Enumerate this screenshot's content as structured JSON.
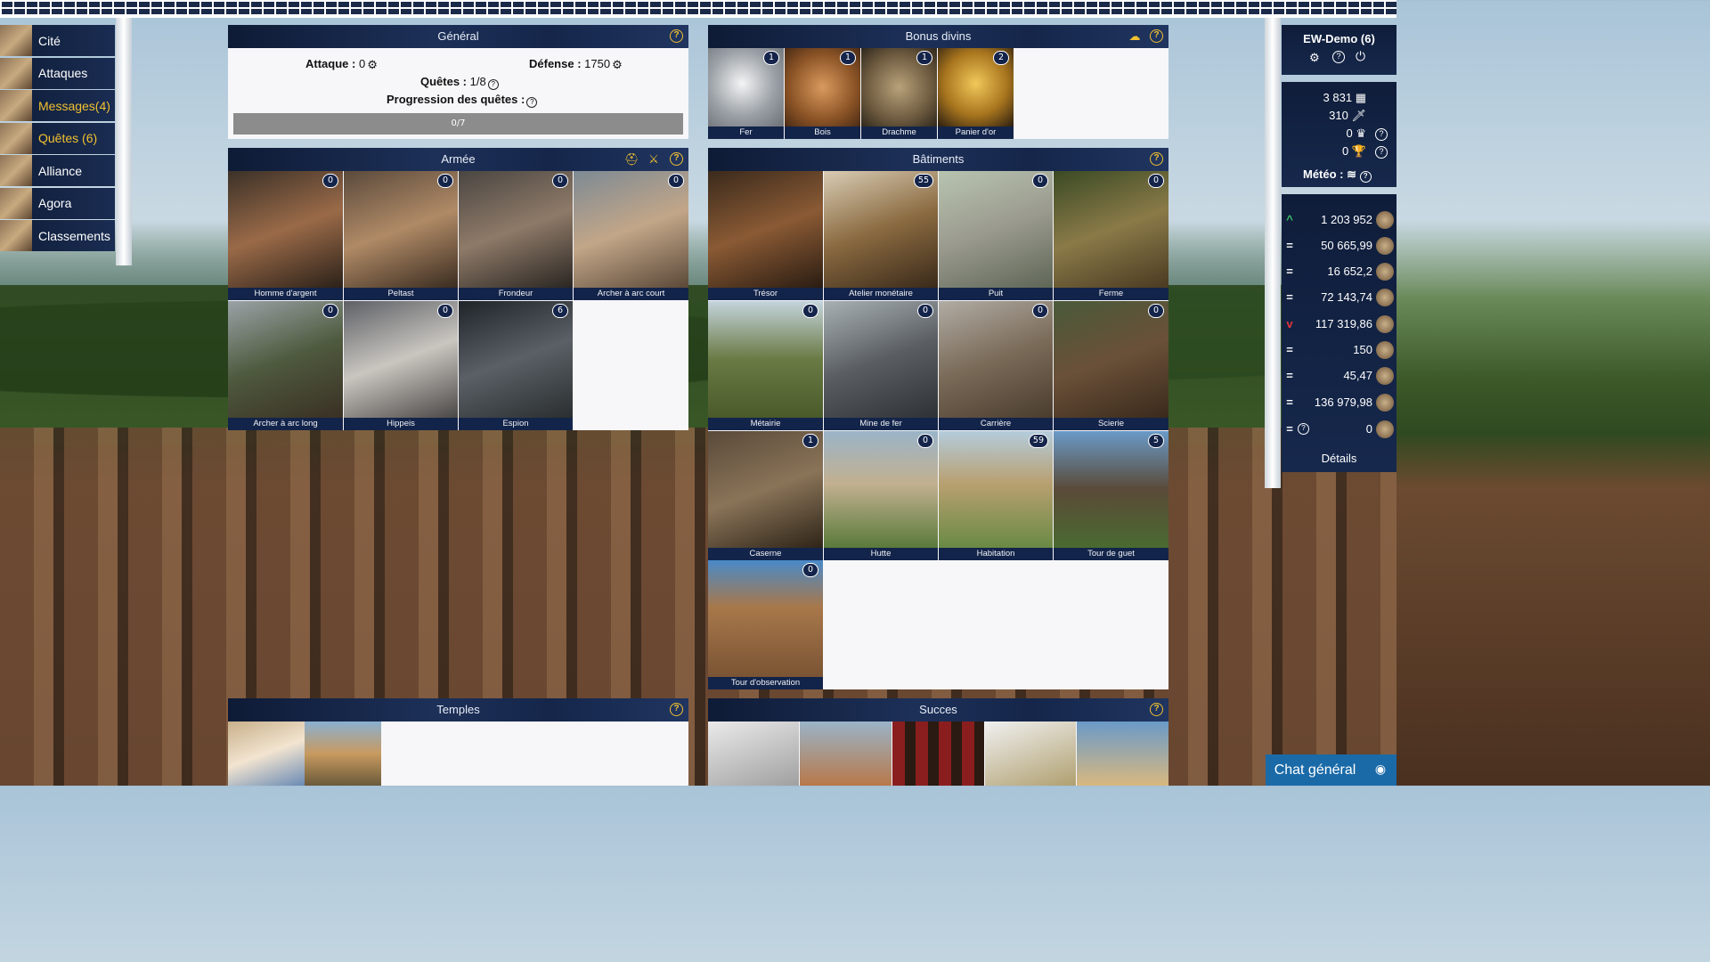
{
  "nav": [
    {
      "label": "Cité",
      "active": false
    },
    {
      "label": "Attaques",
      "active": false
    },
    {
      "label": "Messages(4)",
      "active": true
    },
    {
      "label": "Quêtes (6)",
      "active": true
    },
    {
      "label": "Alliance",
      "active": false
    },
    {
      "label": "Agora",
      "active": false
    },
    {
      "label": "Classements",
      "active": false
    }
  ],
  "general": {
    "title": "Général",
    "attack_label": "Attaque :",
    "attack_value": "0",
    "defense_label": "Défense :",
    "defense_value": "1750",
    "quests_label": "Quêtes :",
    "quests_value": "1/8",
    "progress_label": "Progression des quêtes :",
    "progress_text": "0/7",
    "progress_fraction": 0
  },
  "divine": {
    "title": "Bonus divins",
    "items": [
      {
        "label": "Fer",
        "count": "1"
      },
      {
        "label": "Bois",
        "count": "1"
      },
      {
        "label": "Drachme",
        "count": "1"
      },
      {
        "label": "Panier d'or",
        "count": "2"
      }
    ]
  },
  "army": {
    "title": "Armée",
    "units": [
      {
        "label": "Homme d'argent",
        "count": "0"
      },
      {
        "label": "Peltast",
        "count": "0"
      },
      {
        "label": "Frondeur",
        "count": "0"
      },
      {
        "label": "Archer à arc court",
        "count": "0"
      },
      {
        "label": "Archer à arc long",
        "count": "0"
      },
      {
        "label": "Hippeis",
        "count": "0"
      },
      {
        "label": "Espion",
        "count": "6"
      }
    ]
  },
  "buildings": {
    "title": "Bâtiments",
    "items": [
      {
        "label": "Trésor",
        "count": ""
      },
      {
        "label": "Atelier monétaire",
        "count": "55"
      },
      {
        "label": "Puit",
        "count": "0"
      },
      {
        "label": "Ferme",
        "count": "0"
      },
      {
        "label": "Métairie",
        "count": "0"
      },
      {
        "label": "Mine de fer",
        "count": "0"
      },
      {
        "label": "Carrière",
        "count": "0"
      },
      {
        "label": "Scierie",
        "count": "0"
      },
      {
        "label": "Caserne",
        "count": "1"
      },
      {
        "label": "Hutte",
        "count": "0"
      },
      {
        "label": "Habitation",
        "count": "59"
      },
      {
        "label": "Tour de guet",
        "count": "5"
      },
      {
        "label": "Tour d'observation",
        "count": "0"
      }
    ]
  },
  "temples": {
    "title": "Temples"
  },
  "success": {
    "title": "Succes"
  },
  "player": {
    "name": "EW-Demo (6)",
    "stats": [
      "3 831",
      "310",
      "0",
      "0"
    ],
    "weather_label": "Météo :"
  },
  "resources": [
    {
      "sign": "^",
      "value": "1 203 952"
    },
    {
      "sign": "=",
      "value": "50 665,99"
    },
    {
      "sign": "=",
      "value": "16 652,2"
    },
    {
      "sign": "=",
      "value": "72 143,74"
    },
    {
      "sign": "v",
      "value": "117 319,86"
    },
    {
      "sign": "=",
      "value": "150"
    },
    {
      "sign": "=",
      "value": "45,47"
    },
    {
      "sign": "=",
      "value": "136 979,98"
    },
    {
      "sign": "=",
      "value": "0"
    }
  ],
  "details_label": "Détails",
  "chat_label": "Chat général",
  "colors": {
    "accent": "#f2c130",
    "panel_header": "#13244a",
    "chat": "#1a6aa8"
  }
}
